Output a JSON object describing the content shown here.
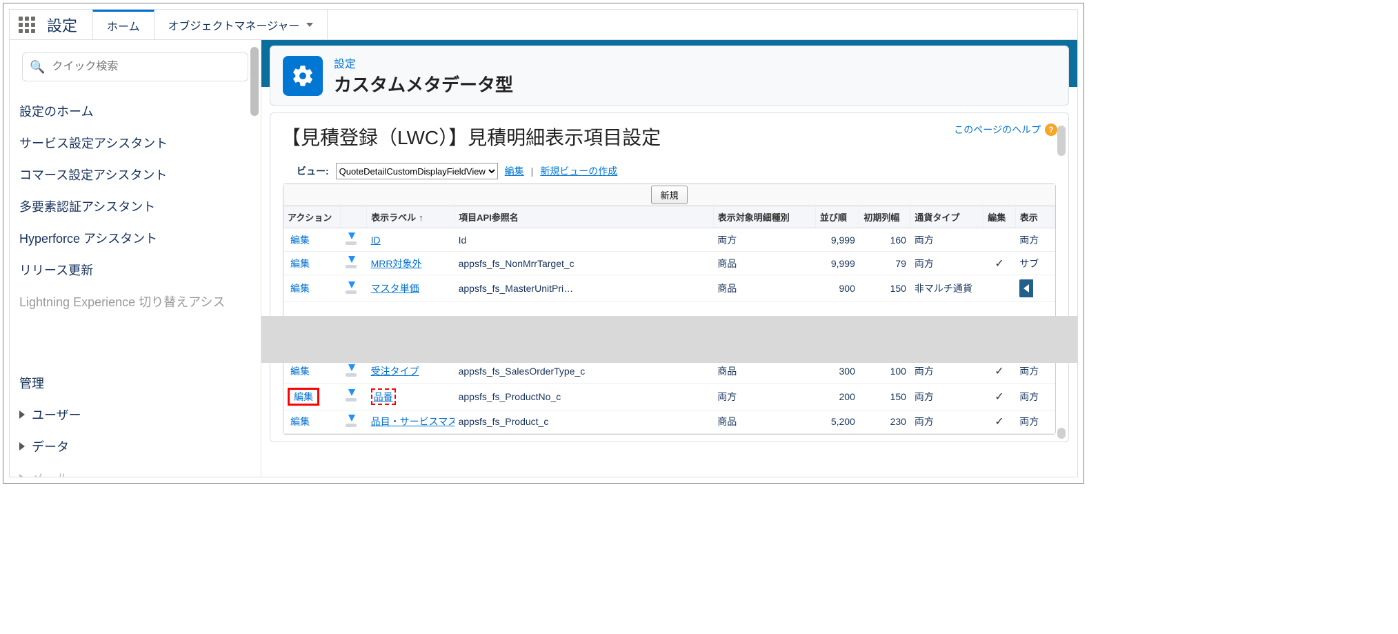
{
  "topbar": {
    "title": "設定",
    "tab_home": "ホーム",
    "tab_object_manager": "オブジェクトマネージャー"
  },
  "sidebar": {
    "search_placeholder": "クイック検索",
    "items": [
      "設定のホーム",
      "サービス設定アシスタント",
      "コマース設定アシスタント",
      "多要素認証アシスタント",
      "Hyperforce アシスタント",
      "リリース更新",
      "Lightning Experience 切り替えアシス"
    ],
    "section_heading": "管理",
    "groups": [
      "ユーザー",
      "データ",
      "メール"
    ]
  },
  "header": {
    "eyebrow": "設定",
    "page_title": "カスタムメタデータ型"
  },
  "classic": {
    "title": "【見積登録（LWC）】見積明細表示項目設定",
    "help_text": "このページのヘルプ",
    "view_label": "ビュー:",
    "view_select": "QuoteDetailCustomDisplayFieldView",
    "edit_view": "編集",
    "new_view": "新規ビューの作成",
    "new_button": "新規",
    "columns": {
      "action": "アクション",
      "label": "表示ラベル",
      "api": "項目API参照名",
      "type": "表示対象明細種別",
      "order": "並び順",
      "width": "初期列幅",
      "currency": "通貨タイプ",
      "editable": "編集",
      "display": "表示"
    },
    "rows_top": [
      {
        "label": "ID",
        "api": "Id",
        "type": "両方",
        "order": "9,999",
        "width": "160",
        "cur": "両方",
        "edit": "",
        "disp": "両方"
      },
      {
        "label": "MRR対象外",
        "api": "appsfs_fs_NonMrrTarget_c",
        "type": "商品",
        "order": "9,999",
        "width": "79",
        "cur": "両方",
        "edit": "✓",
        "disp": "サブ"
      },
      {
        "label": "マスタ単価",
        "api": "appsfs_fs_MasterUnitPri…",
        "type": "商品",
        "order": "900",
        "width": "150",
        "cur": "非マルチ通貨",
        "edit": "",
        "disp": ""
      }
    ],
    "rows_bottom": [
      {
        "label": "受注タイプ",
        "api": "appsfs_fs_SalesOrderType_c",
        "type": "商品",
        "order": "300",
        "width": "100",
        "cur": "両方",
        "edit": "✓",
        "disp": "両方",
        "hl": false
      },
      {
        "label": "品番",
        "api": "appsfs_fs_ProductNo_c",
        "type": "両方",
        "order": "200",
        "width": "150",
        "cur": "両方",
        "edit": "✓",
        "disp": "両方",
        "hl": true
      },
      {
        "label": "品目・サービスマスタ",
        "api": "appsfs_fs_Product_c",
        "type": "商品",
        "order": "5,200",
        "width": "230",
        "cur": "両方",
        "edit": "✓",
        "disp": "両方",
        "hl": false
      }
    ],
    "edit_action": "編集"
  }
}
